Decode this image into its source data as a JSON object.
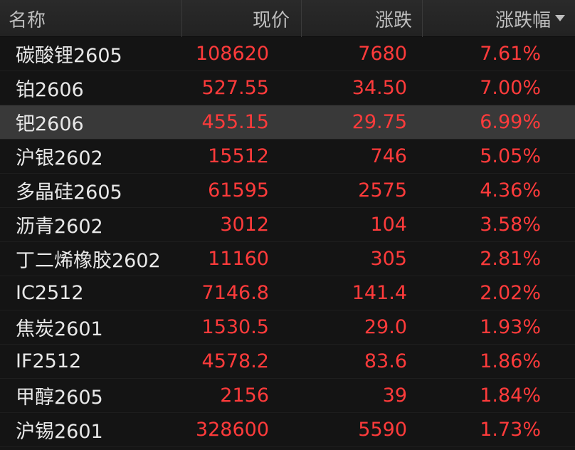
{
  "header": {
    "name_label": "名称",
    "price_label": "现价",
    "change_label": "涨跌",
    "pct_label": "涨跌幅",
    "sort_indicator": "caret-down-icon"
  },
  "colors": {
    "up": "#ff3b3b",
    "name_text": "#e8e8e8",
    "header_text": "#bdbdbd",
    "selected_row": "#393939",
    "background": "#151515"
  },
  "selected_row_index": 2,
  "rows": [
    {
      "name": "碳酸锂2605",
      "price": "108620",
      "change": "7680",
      "pct": "7.61%"
    },
    {
      "name": "铂2606",
      "price": "527.55",
      "change": "34.50",
      "pct": "7.00%"
    },
    {
      "name": "钯2606",
      "price": "455.15",
      "change": "29.75",
      "pct": "6.99%"
    },
    {
      "name": "沪银2602",
      "price": "15512",
      "change": "746",
      "pct": "5.05%"
    },
    {
      "name": "多晶硅2605",
      "price": "61595",
      "change": "2575",
      "pct": "4.36%"
    },
    {
      "name": "沥青2602",
      "price": "3012",
      "change": "104",
      "pct": "3.58%"
    },
    {
      "name": "丁二烯橡胶2602",
      "price": "11160",
      "change": "305",
      "pct": "2.81%"
    },
    {
      "name": "IC2512",
      "price": "7146.8",
      "change": "141.4",
      "pct": "2.02%"
    },
    {
      "name": "焦炭2601",
      "price": "1530.5",
      "change": "29.0",
      "pct": "1.93%"
    },
    {
      "name": "IF2512",
      "price": "4578.2",
      "change": "83.6",
      "pct": "1.86%"
    },
    {
      "name": "甲醇2605",
      "price": "2156",
      "change": "39",
      "pct": "1.84%"
    },
    {
      "name": "沪锡2601",
      "price": "328600",
      "change": "5590",
      "pct": "1.73%"
    }
  ]
}
